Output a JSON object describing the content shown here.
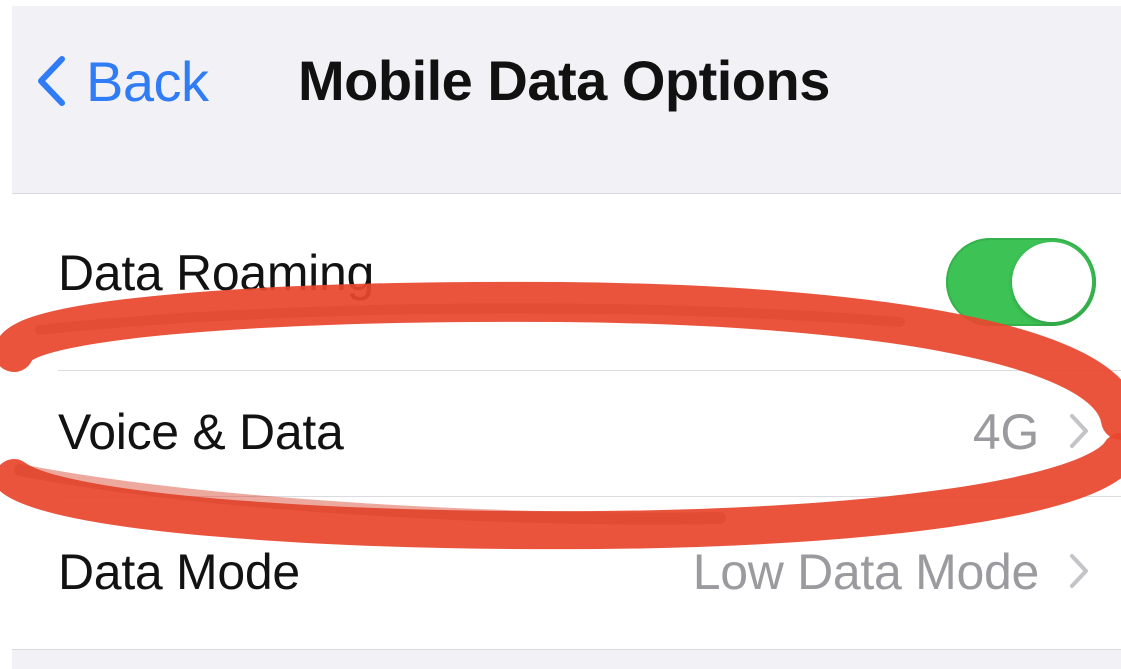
{
  "nav": {
    "back_label": "Back",
    "back_icon": "chevron-left-icon",
    "title": "Mobile Data Options"
  },
  "settings": [
    {
      "label": "Data Roaming",
      "control": "toggle",
      "on": true
    },
    {
      "label": "Voice & Data",
      "value": "4G",
      "control": "disclosure"
    },
    {
      "label": "Data Mode",
      "value": "Low Data Mode",
      "control": "disclosure"
    }
  ],
  "colors": {
    "accent": "#2f7cf6",
    "toggle_on": "#3cc255",
    "annotation": "#e8472e"
  }
}
